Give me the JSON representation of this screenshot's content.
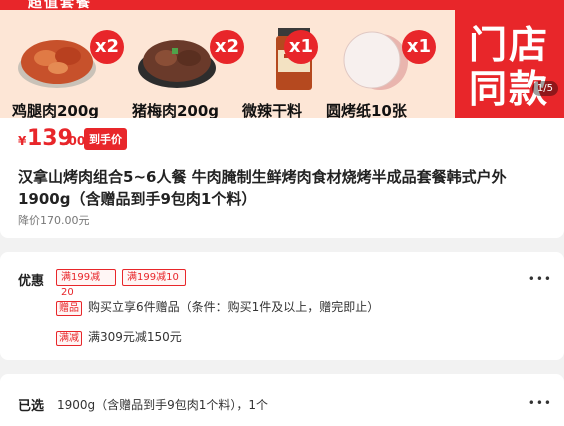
{
  "banner": {
    "top_text": "超值套餐",
    "store_line1": "门店",
    "store_line2": "同款",
    "page_indicator": "1/5",
    "items": [
      {
        "label": "鸡腿肉200g",
        "times": "x2",
        "icon": "marinated-chicken-icon"
      },
      {
        "label": "猪梅肉200g",
        "times": "x2",
        "icon": "pork-meat-icon"
      },
      {
        "label": "微辣干料",
        "times": "x1",
        "icon": "spice-bottle-icon"
      },
      {
        "label": "圆烤纸10张",
        "times": "x1",
        "icon": "baking-paper-icon"
      }
    ]
  },
  "price": {
    "currency": "¥",
    "integer": "139",
    "decimal": ".00",
    "badge": "到手价",
    "title": "汉拿山烤肉组合5~6人餐 牛肉腌制生鲜烤肉食材烧烤半成品套餐韩式户外1900g（含赠品到手9包肉1个料）",
    "original": "降价170.00元"
  },
  "promo": {
    "label": "优惠",
    "coupons": [
      "满199减20",
      "满199减10"
    ],
    "more": "•••",
    "rows": [
      {
        "tag": "赠品",
        "text": "购买立享6件赠品（条件：购买1件及以上，赠完即止）"
      },
      {
        "tag": "满减",
        "text": "满309元减150元"
      }
    ]
  },
  "selected": {
    "label": "已选",
    "value": "1900g（含赠品到手9包肉1个料），1个",
    "more": "•••"
  },
  "colors": {
    "accent": "#e8262a",
    "banner_bg": "#fde6d6"
  }
}
